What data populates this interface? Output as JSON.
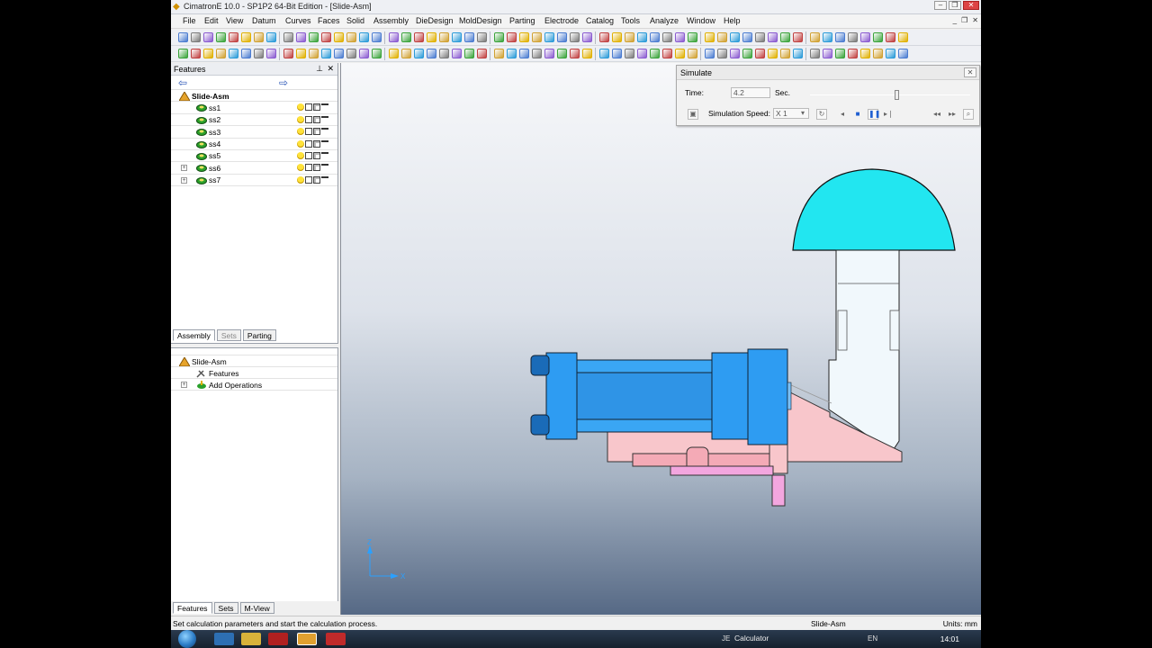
{
  "window": {
    "title": "CimatronE 10.0 - SP1P2 64-Bit Edition - [Slide-Asm]"
  },
  "menu": [
    "File",
    "Edit",
    "View",
    "Datum",
    "Curves",
    "Faces",
    "Solid",
    "Assembly",
    "DieDesign",
    "MoldDesign",
    "Parting",
    "Electrode",
    "Catalog",
    "Tools",
    "Analyze",
    "Window",
    "Help"
  ],
  "features_panel": {
    "title": "Features",
    "root": "Slide-Asm",
    "items": [
      {
        "name": "ss1",
        "expandable": false
      },
      {
        "name": "ss2",
        "expandable": false
      },
      {
        "name": "ss3",
        "expandable": false
      },
      {
        "name": "ss4",
        "expandable": false
      },
      {
        "name": "ss5",
        "expandable": false
      },
      {
        "name": "ss6",
        "expandable": true
      },
      {
        "name": "ss7",
        "expandable": true
      }
    ],
    "tabs": [
      "Assembly",
      "Sets",
      "Parting"
    ]
  },
  "assembly_panel": {
    "root": "Slide-Asm",
    "items": [
      "Features",
      "Add Operations"
    ],
    "tabs": [
      "Features",
      "Sets",
      "M-View"
    ]
  },
  "simulate": {
    "title": "Simulate",
    "time_label": "Time:",
    "time_value": "4.2",
    "time_unit": "Sec.",
    "time_fraction": 0.54,
    "speed_label": "Simulation Speed:",
    "speed_value": "X 1"
  },
  "axes": {
    "z": "Z",
    "x": "X"
  },
  "status": {
    "message": "Set calculation parameters and start the calculation process.",
    "document": "Slide-Asm",
    "units": "Units: mm"
  },
  "taskbar": {
    "language": "EN",
    "calculator": "Calculator",
    "clock": "14:01"
  },
  "colors": {
    "cylinder": "#2e9cf2",
    "slide_body": "#f8c6cb",
    "head": "#22e6f0",
    "guide": "#f1f8fc",
    "rod": "#f4aab6",
    "bracket": "#f3a6df"
  }
}
